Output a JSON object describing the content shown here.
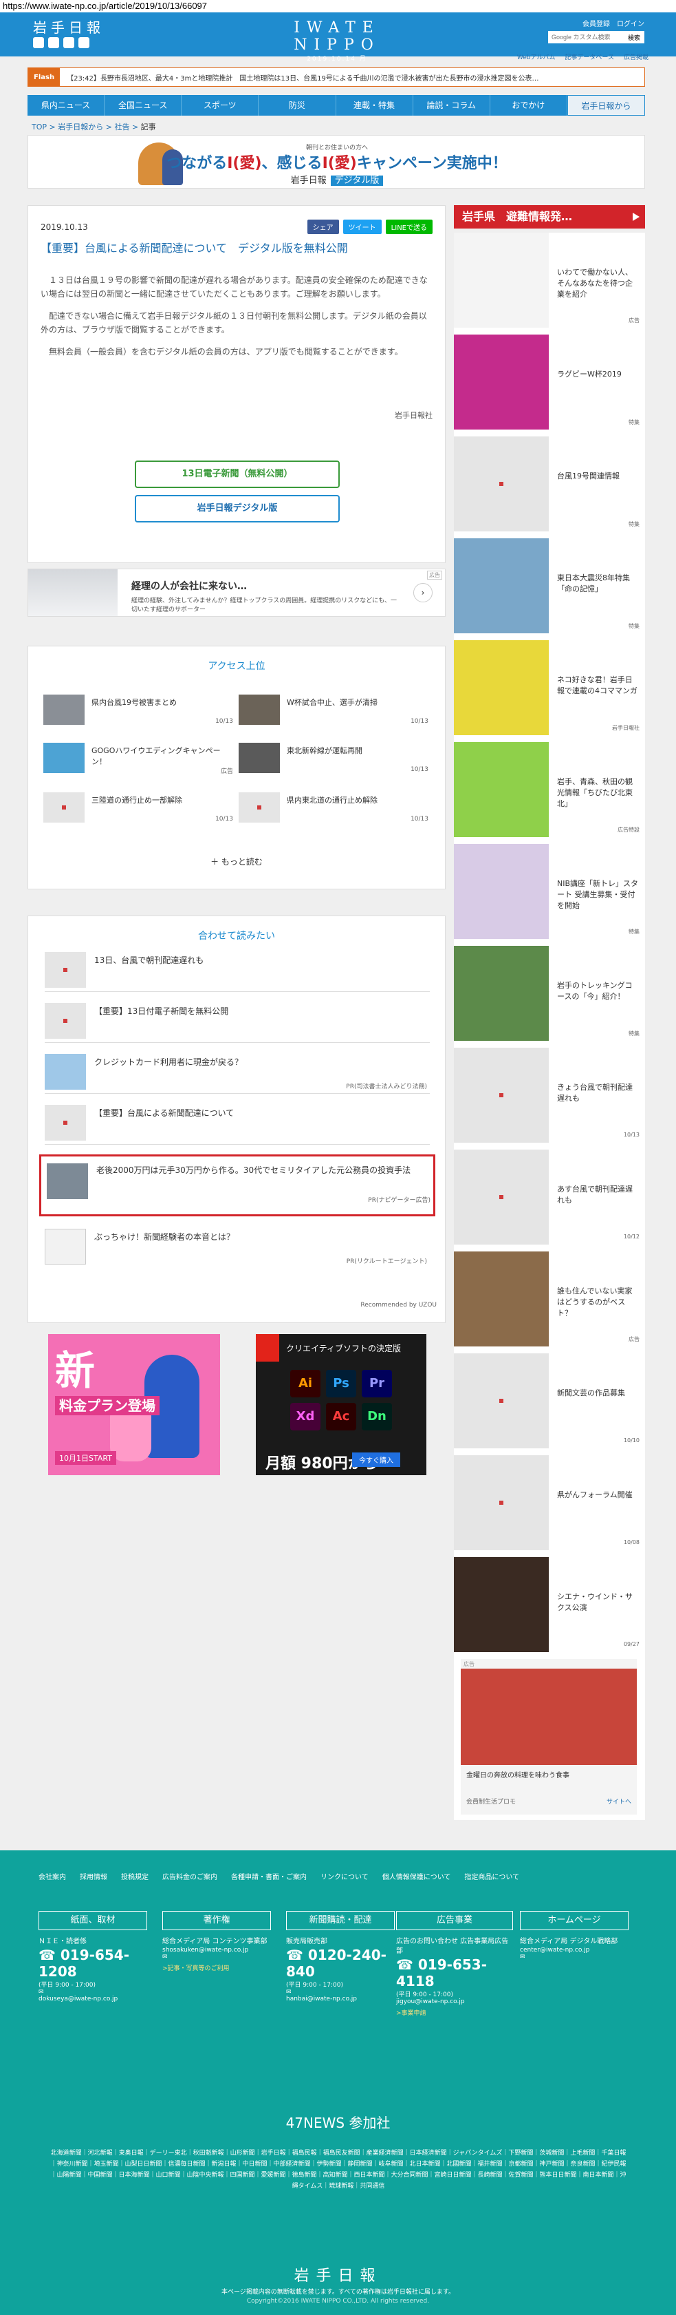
{
  "url": "https://www.iwate-np.co.jp/article/2019/10/13/66097",
  "header": {
    "logo_small": "岩手日報",
    "center_logo": "IWATE NIPPO",
    "date": "2019.10.14 月",
    "tagline": "",
    "register": "会員登録",
    "login": "ログイン",
    "search_placeholder": "Google カスタム検索",
    "search_button": "検索",
    "web_links": [
      "Webアルバム",
      "記事データベース",
      "広告掲載"
    ]
  },
  "flash": {
    "label": "Flash",
    "text": "【23:42】長野市長沼地区、最大4・3mと地理院推計　国土地理院は13日、台風19号による千曲川の氾濫で浸水被害が出た長野市の浸水推定図を公表…"
  },
  "nav": [
    "県内ニュース",
    "全国ニュース",
    "スポーツ",
    "防災",
    "連載・特集",
    "論説・コラム",
    "おでかけ",
    "岩手日報から"
  ],
  "breadcrumb": [
    "TOP",
    "岩手日報から",
    "社告",
    "記事"
  ],
  "banner": {
    "pre": "朝刊とお住まいの方へ",
    "main_a": "つながる",
    "main_b": "I(愛)",
    "main_c": "、感じる",
    "main_d": "I(愛)",
    "main_e": "キャンペーン実施中！",
    "sub": "岩手日報",
    "digital": "デジタル版"
  },
  "article": {
    "date": "2019.10.13",
    "share_fb": "シェア",
    "share_tw": "ツイート",
    "share_line": "LINEで送る",
    "title": "【重要】台風による新聞配達について　デジタル版を無料公開",
    "p1": "１３日は台風１９号の影響で新聞の配達が遅れる場合があります。配達員の安全確保のため配達できない場合には翌日の新聞と一緒に配達させていただくこともあります。ご理解をお願いします。",
    "p2": "配達できない場合に備えて岩手日報デジタル紙の１３日付朝刊を無料公開します。デジタル紙の会員以外の方は、ブラウザ版で閲覧することができます。",
    "p3": "無料会員（一般会員）を含むデジタル紙の会員の方は、アプリ版でも閲覧することができます。",
    "byline": "岩手日報社",
    "btn_green": "13日電子新聞（無料公開）",
    "btn_blue": "岩手日報デジタル版"
  },
  "ad_strip": {
    "tag": "広告",
    "title": "経理の人が会社に来ない…",
    "text": "経理の経験、外注してみませんか？経理トップクラスの周囲員。経理提携のリスクなどにも、一切いたす経理のサポーター"
  },
  "access": {
    "title": "アクセス上位",
    "items": [
      {
        "title": "県内台風19号被害まとめ",
        "date": "10/13"
      },
      {
        "title": "W杯試合中止、選手が清掃",
        "date": "10/13"
      },
      {
        "title": "GOGOハワイウエディングキャンペーン！",
        "date": "広告"
      },
      {
        "title": "東北新幹線が運転再開",
        "date": "10/13"
      },
      {
        "title": "三陸道の通行止め一部解除",
        "date": "10/13"
      },
      {
        "title": "県内東北道の通行止め解除",
        "date": "10/13"
      }
    ],
    "more": "もっと読む"
  },
  "related": {
    "title": "合わせて読みたい",
    "items": [
      {
        "title": "13日、台風で朝刊配達遅れも",
        "pr": ""
      },
      {
        "title": "【重要】13日付電子新聞を無料公開",
        "pr": ""
      },
      {
        "title": "クレジットカード利用者に現金が戻る？",
        "pr": "PR(司法書士法人みどり法務)"
      },
      {
        "title": "【重要】台風による新聞配達について",
        "pr": ""
      },
      {
        "title": "老後2000万円は元手30万円から作る。30代でセミリタイアした元公務員の投資手法",
        "pr": "PR(ナビゲーター広告)"
      },
      {
        "title": "ぶっちゃけ！新聞経験者の本音とは？",
        "pr": "PR(リクルートエージェント)"
      }
    ],
    "recby": "Recommended by UZOU"
  },
  "ad_a": {
    "big": "新",
    "mid": "料金プラン登場",
    "bot": "10月1日START"
  },
  "ad_b": {
    "head": "クリエイティブソフトの決定版",
    "icons": [
      "Ai",
      "Ps",
      "Pr",
      "Xd",
      "Ac",
      "Dn"
    ],
    "price": "月額 980円から",
    "buy": "今すぐ購入"
  },
  "sidebar": {
    "title": "岩手県　避難情報発…",
    "items": [
      {
        "title": "いわてで働かない人、そんなあなたを待つ企業を紹介",
        "date": "広告"
      },
      {
        "title": "ラグビーW杯2019",
        "date": "特集"
      },
      {
        "title": "台風19号関連情報",
        "date": "特集"
      },
      {
        "title": "東日本大震災8年特集「命の記憶」",
        "date": "特集"
      },
      {
        "title": "ネコ好きな君！岩手日報で連載の4コママンガ",
        "date": "岩手日報社"
      },
      {
        "title": "岩手、青森、秋田の観光情報「ちびたび北東北」",
        "date": "広告特設"
      },
      {
        "title": "NIB講座「新トレ」スタート 受講生募集・受付を開始",
        "date": "特集"
      },
      {
        "title": "岩手のトレッキングコースの「今」紹介！",
        "date": "特集"
      },
      {
        "title": "きょう台風で朝刊配達遅れも",
        "date": "10/13"
      },
      {
        "title": "あす台風で朝刊配達遅れも",
        "date": "10/12"
      },
      {
        "title": "誰も住んでいない実家はどうするのがベスト？",
        "date": "広告"
      },
      {
        "title": "新聞文芸の作品募集",
        "date": "10/10"
      },
      {
        "title": "県がんフォーラム開催",
        "date": "10/08"
      },
      {
        "title": "シエナ・ウインド・サクス公演",
        "date": "09/27"
      }
    ],
    "ad_tag": "広告",
    "ad_text": "金曜日の奔放の料理を味わう食事",
    "ad_brand": "会員制生活プロモ",
    "ad_site": "サイトへ"
  },
  "footer": {
    "links": [
      "会社案内",
      "採用情報",
      "投稿規定",
      "広告料金のご案内",
      "各種申請・書面・ご案内",
      "リンクについて",
      "個人情報保護について",
      "指定商品について"
    ],
    "boxes": [
      {
        "head": "紙面、取材",
        "l1": "ＮＩＥ・読者係",
        "tel": "019-654-1208",
        "hours": "(平日 9:00 - 17:00)",
        "mail": "dokuseya@iwate-np.co.jp",
        "link": ""
      },
      {
        "head": "著作権",
        "l1": "総合メディア局 コンテンツ事業部",
        "tel": "",
        "hours": "",
        "mail": "shosakuken@iwate-np.co.jp",
        "link": ">記事・写真等のご利用"
      },
      {
        "head": "新聞購読・配達",
        "l1": "販売局販売部",
        "tel": "0120-240-840",
        "hours": "(平日 9:00 - 17:00)",
        "mail": "hanbai@iwate-np.co.jp",
        "link": ""
      },
      {
        "head": "広告事業",
        "l1": "広告のお問い合わせ 広告事業局広告部",
        "tel": "019-653-4118",
        "hours": "(平日 9:00 - 17:00)",
        "mail": "jigyou@iwate-np.co.jp",
        "link": ">事業申請"
      },
      {
        "head": "ホームページ",
        "l1": "総合メディア局 デジタル戦略部",
        "tel": "",
        "hours": "",
        "mail": "center@iwate-np.co.jp",
        "link": ""
      }
    ],
    "news47": "47NEWS 参加社",
    "news_links": "北海道新聞｜河北新報｜東奥日報｜デーリー東北｜秋田魁新報｜山形新聞｜岩手日報｜福島民報｜福島民友新聞｜産業経済新聞｜日本経済新聞｜ジャパンタイムズ｜下野新聞｜茨城新聞｜上毛新聞｜千葉日報｜神奈川新聞｜埼玉新聞｜山梨日日新聞｜信濃毎日新聞｜新潟日報｜中日新聞｜中部経済新聞｜伊勢新聞｜静岡新聞｜岐阜新聞｜北日本新聞｜北國新聞｜福井新聞｜京都新聞｜神戸新聞｜奈良新聞｜紀伊民報｜山陽新聞｜中国新聞｜日本海新聞｜山口新聞｜山陰中央新報｜四国新聞｜愛媛新聞｜徳島新聞｜高知新聞｜西日本新聞｜大分合同新聞｜宮崎日日新聞｜長崎新聞｜佐賀新聞｜熊本日日新聞｜南日本新聞｜沖縄タイムス｜琉球新報｜共同通信",
    "logo": "岩手日報",
    "copy1": "本ページ掲載内容の無断転載を禁じます。すべての著作権は岩手日報社に属します。",
    "copy2": "Copyright©2016 IWATE NIPPO CO.,LTD. All rights reserved."
  }
}
